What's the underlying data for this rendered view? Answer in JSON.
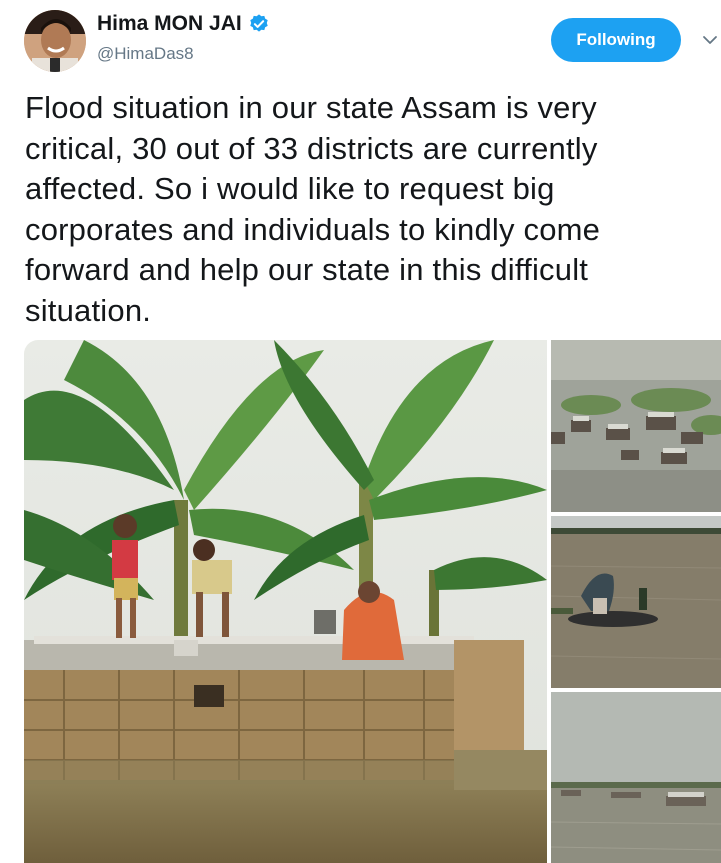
{
  "author": {
    "name": "Hima MON JAI",
    "handle": "@HimaDas8",
    "verified": true
  },
  "follow_button": {
    "label": "Following"
  },
  "tweet": {
    "lines": [
      "Flood situation in our state Assam is very",
      "critical, 30 out of 33 districts are currently",
      "affected. So i would like to request big",
      "corporates and individuals to kindly come",
      "forward and help our state in this difficult",
      "situation."
    ]
  },
  "media": {
    "count": 4,
    "icons": [
      "verified-icon",
      "chevron-down-icon"
    ]
  },
  "colors": {
    "accent": "#1da1f2",
    "text": "#14171a",
    "secondary_text": "#657786"
  }
}
